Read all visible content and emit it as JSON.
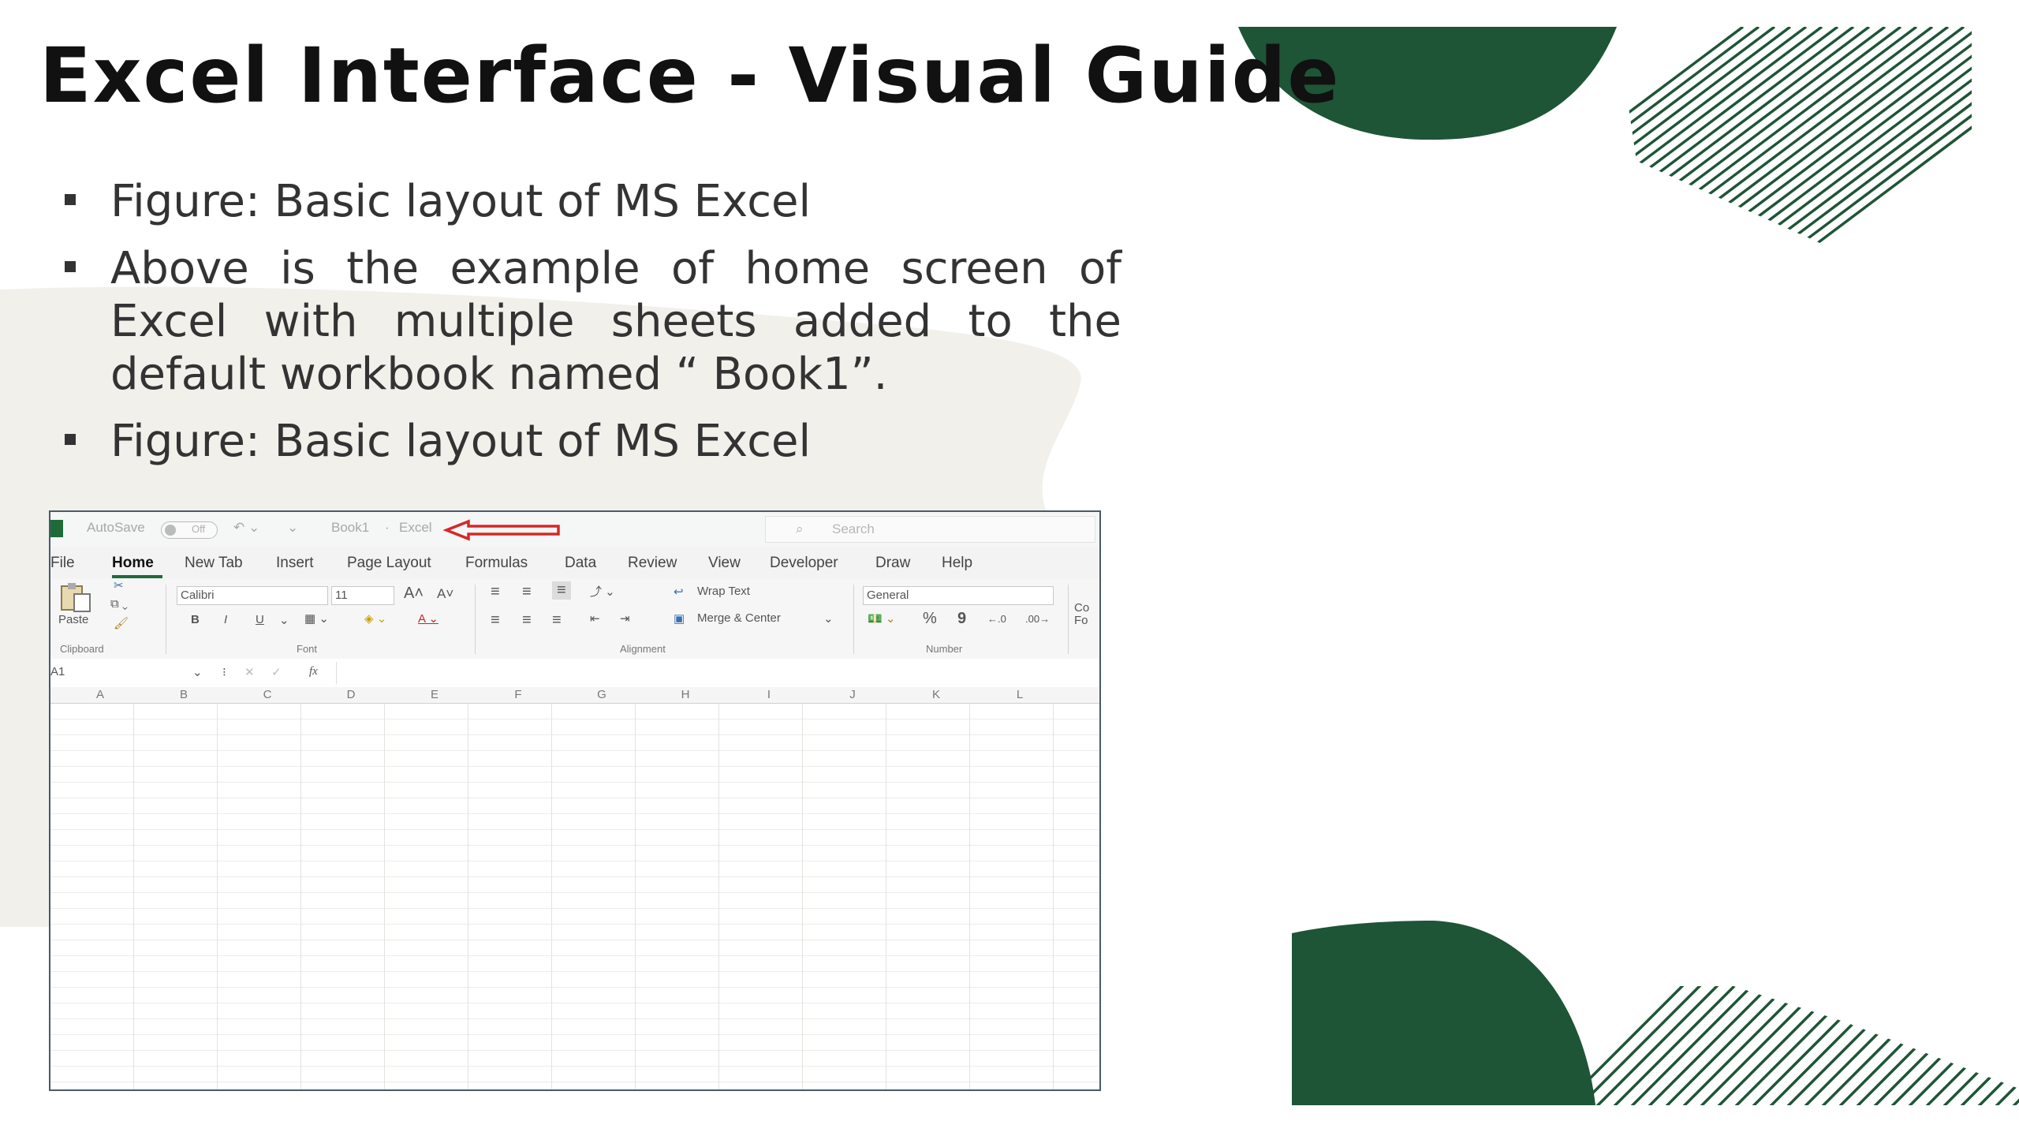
{
  "slide": {
    "title": "Excel Interface - Visual Guide",
    "bullets": [
      "Figure: Basic layout of MS Excel",
      "Above is the example of home screen of Excel with multiple sheets added to the default workbook named “ Book1”.",
      "Figure: Basic layout of MS Excel"
    ],
    "colors": {
      "accent": "#1e5536",
      "blob": "#f1f0eb",
      "arrow": "#d62828"
    }
  },
  "excel": {
    "quick_access": {
      "autosave": "AutoSave",
      "toggle": "Off",
      "workbook": "Book1",
      "app": "Excel",
      "search": "Search"
    },
    "menu": [
      "File",
      "Home",
      "New Tab",
      "Insert",
      "Page Layout",
      "Formulas",
      "Data",
      "Review",
      "View",
      "Developer",
      "Draw",
      "Help"
    ],
    "ribbon": {
      "paste": "Paste",
      "font_name": "Calibri",
      "font_size": "11",
      "grow_font": "A˄",
      "shrink_font": "A˅",
      "bold": "B",
      "italic": "I",
      "underline": "U",
      "wrap_text": "Wrap Text",
      "merge_center": "Merge & Center",
      "number_format": "General",
      "percent": "%",
      "comma": "9",
      "inc_decimal": "←.0",
      "dec_decimal": ".00→",
      "cond_format": "Co Fo",
      "groups": {
        "clipboard": "Clipboard",
        "font": "Font",
        "alignment": "Alignment",
        "number": "Number"
      }
    },
    "formula_bar": {
      "name_box": "A1",
      "fx": "fx"
    },
    "columns": [
      "A",
      "B",
      "C",
      "D",
      "E",
      "F",
      "G",
      "H",
      "I",
      "J",
      "K",
      "L"
    ]
  }
}
